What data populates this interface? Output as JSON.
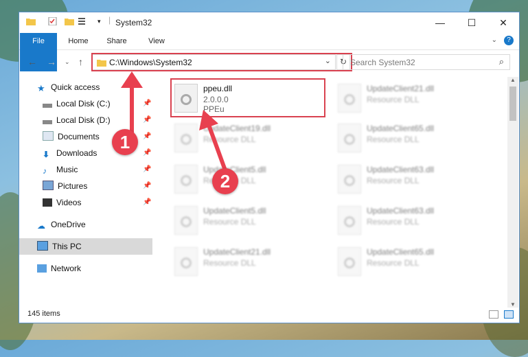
{
  "window": {
    "title": "System32"
  },
  "ribbon": {
    "tabs": [
      "File",
      "Home",
      "Share",
      "View"
    ]
  },
  "address": {
    "path": "C:\\Windows\\System32"
  },
  "search": {
    "placeholder": "Search System32"
  },
  "nav": {
    "items": [
      {
        "label": "Quick access",
        "icon": "star-icon",
        "pinned": false
      },
      {
        "label": "Local Disk (C:)",
        "icon": "drive-icon",
        "pinned": true
      },
      {
        "label": "Local Disk (D:)",
        "icon": "drive-icon",
        "pinned": true
      },
      {
        "label": "Documents",
        "icon": "documents-icon",
        "pinned": true
      },
      {
        "label": "Downloads",
        "icon": "download-icon",
        "pinned": true
      },
      {
        "label": "Music",
        "icon": "music-icon",
        "pinned": true
      },
      {
        "label": "Pictures",
        "icon": "pictures-icon",
        "pinned": true
      },
      {
        "label": "Videos",
        "icon": "videos-icon",
        "pinned": true
      },
      {
        "label": "OneDrive",
        "icon": "cloud-icon",
        "pinned": false
      },
      {
        "label": "This PC",
        "icon": "computer-icon",
        "pinned": false,
        "selected": true
      },
      {
        "label": "Network",
        "icon": "network-icon",
        "pinned": false
      }
    ]
  },
  "files": [
    {
      "name": "ppeu.dll",
      "line2": "2.0.0.0",
      "line3": "PPEu",
      "highlighted": true
    },
    {
      "name": "UpdateClient21.dll",
      "line2": "Resource DLL"
    },
    {
      "name": "UpdateClient19.dll",
      "line2": "Resource DLL"
    },
    {
      "name": "UpdateClient65.dll",
      "line2": "Resource DLL"
    },
    {
      "name": "UpdateClient5.dll",
      "line2": "Resource DLL"
    },
    {
      "name": "UpdateClient63.dll",
      "line2": "Resource DLL"
    },
    {
      "name": "UpdateClient5.dll",
      "line2": "Resource DLL"
    },
    {
      "name": "UpdateClient63.dll",
      "line2": "Resource DLL"
    },
    {
      "name": "UpdateClient21.dll",
      "line2": "Resource DLL"
    },
    {
      "name": "UpdateClient65.dll",
      "line2": "Resource DLL"
    }
  ],
  "status": {
    "count": "145 items"
  },
  "annotations": {
    "badge1": "1",
    "badge2": "2",
    "accent": "#e8404f"
  }
}
